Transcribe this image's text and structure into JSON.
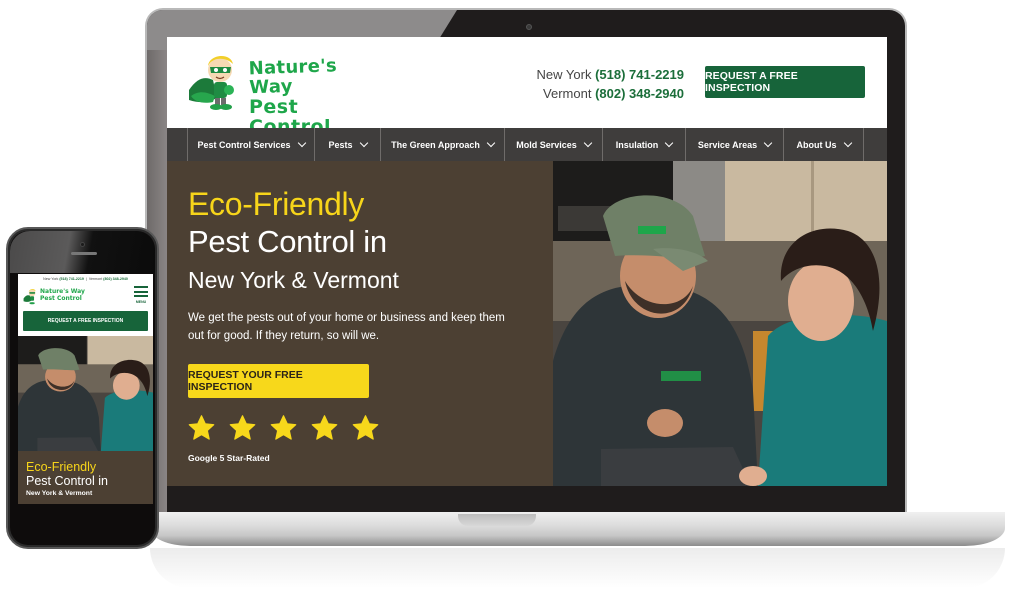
{
  "site": {
    "brand": {
      "line1": "Nature's Way",
      "line2": "Pest Control",
      "mascot_icon": "superhero-mascot-logo"
    },
    "header": {
      "phones": [
        {
          "region": "New York",
          "number": "(518) 741-2219"
        },
        {
          "region": "Vermont",
          "number": "(802) 348-2940"
        }
      ],
      "cta_label": "REQUEST A FREE INSPECTION"
    },
    "nav": {
      "items": [
        {
          "label": "Pest Control Services",
          "icon": "chevron-down-icon"
        },
        {
          "label": "Pests",
          "icon": "chevron-down-icon"
        },
        {
          "label": "The Green Approach",
          "icon": "chevron-down-icon"
        },
        {
          "label": "Mold Services",
          "icon": "chevron-down-icon"
        },
        {
          "label": "Insulation",
          "icon": "chevron-down-icon"
        },
        {
          "label": "Service Areas",
          "icon": "chevron-down-icon"
        },
        {
          "label": "About Us",
          "icon": "chevron-down-icon"
        }
      ]
    },
    "hero": {
      "heading_highlight": "Eco-Friendly",
      "heading_main": "Pest Control in",
      "heading_sub": "New York & Vermont",
      "body": "We get the pests out of your home or business and keep them out for good. If they return, so will we.",
      "cta_label": "REQUEST YOUR FREE INSPECTION",
      "rating": {
        "stars": 5,
        "max": 5,
        "label": "Google 5 Star-Rated"
      },
      "photo_alt": "Technician in green cap showing a tablet to a smiling customer in a kitchen"
    }
  },
  "mobile": {
    "phones": {
      "ny_label": "New York",
      "ny_number": "(518) 741-2219",
      "vt_label": "Vermont",
      "vt_number": "(802) 348-2940"
    },
    "menu_label": "MENU",
    "cta_label": "REQUEST A FREE INSPECTION",
    "hero": {
      "heading_highlight": "Eco-Friendly",
      "heading_main": "Pest Control in",
      "heading_sub": "New York & Vermont"
    }
  },
  "colors": {
    "brand_green": "#17643a",
    "logo_green": "#1ea64a",
    "accent_yellow": "#f7d81b",
    "hero_brown": "#4c4033",
    "nav_dark": "#3f3d3c"
  }
}
